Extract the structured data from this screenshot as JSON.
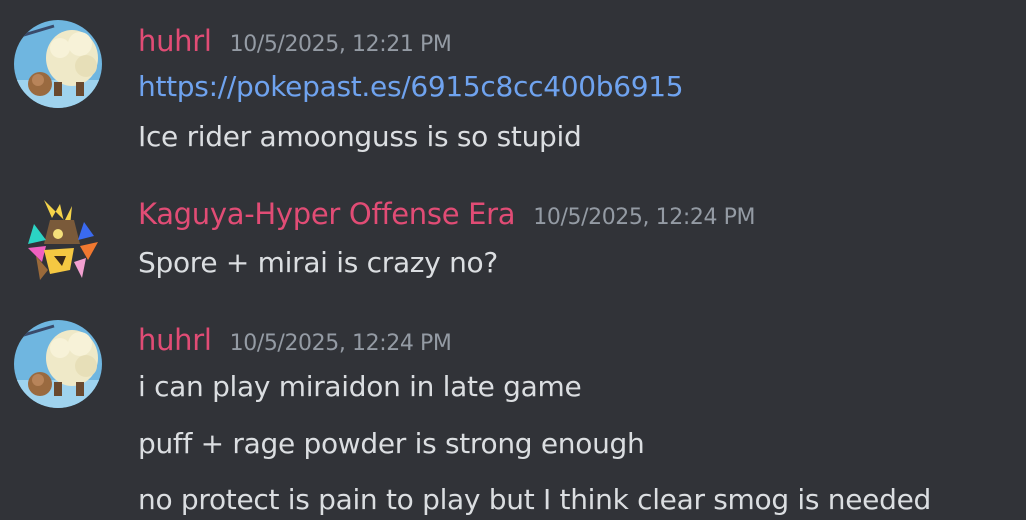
{
  "messages": [
    {
      "username": "huhrl",
      "timestamp": "10/5/2025, 12:21 PM",
      "lines": [
        {
          "text": "https://pokepast.es/6915c8cc400b6915"
        },
        {
          "text": "Ice rider amoonguss is so stupid"
        }
      ]
    },
    {
      "username": "Kaguya-Hyper Offense Era",
      "timestamp": "10/5/2025, 12:24 PM",
      "lines": [
        {
          "text": "Spore + mirai is crazy no?"
        }
      ]
    },
    {
      "username": "huhrl",
      "timestamp": "10/5/2025, 12:24 PM",
      "lines": [
        {
          "text": "i can play miraidon in late game"
        },
        {
          "text": "puff + rage powder is strong enough"
        },
        {
          "text": "no protect is pain to play but I think clear smog is needed"
        }
      ]
    }
  ],
  "colors": {
    "background": "#313338",
    "username": "#e14c75",
    "timestamp": "#949ba4",
    "text": "#dbdee1",
    "link": "#6fa3ef"
  }
}
